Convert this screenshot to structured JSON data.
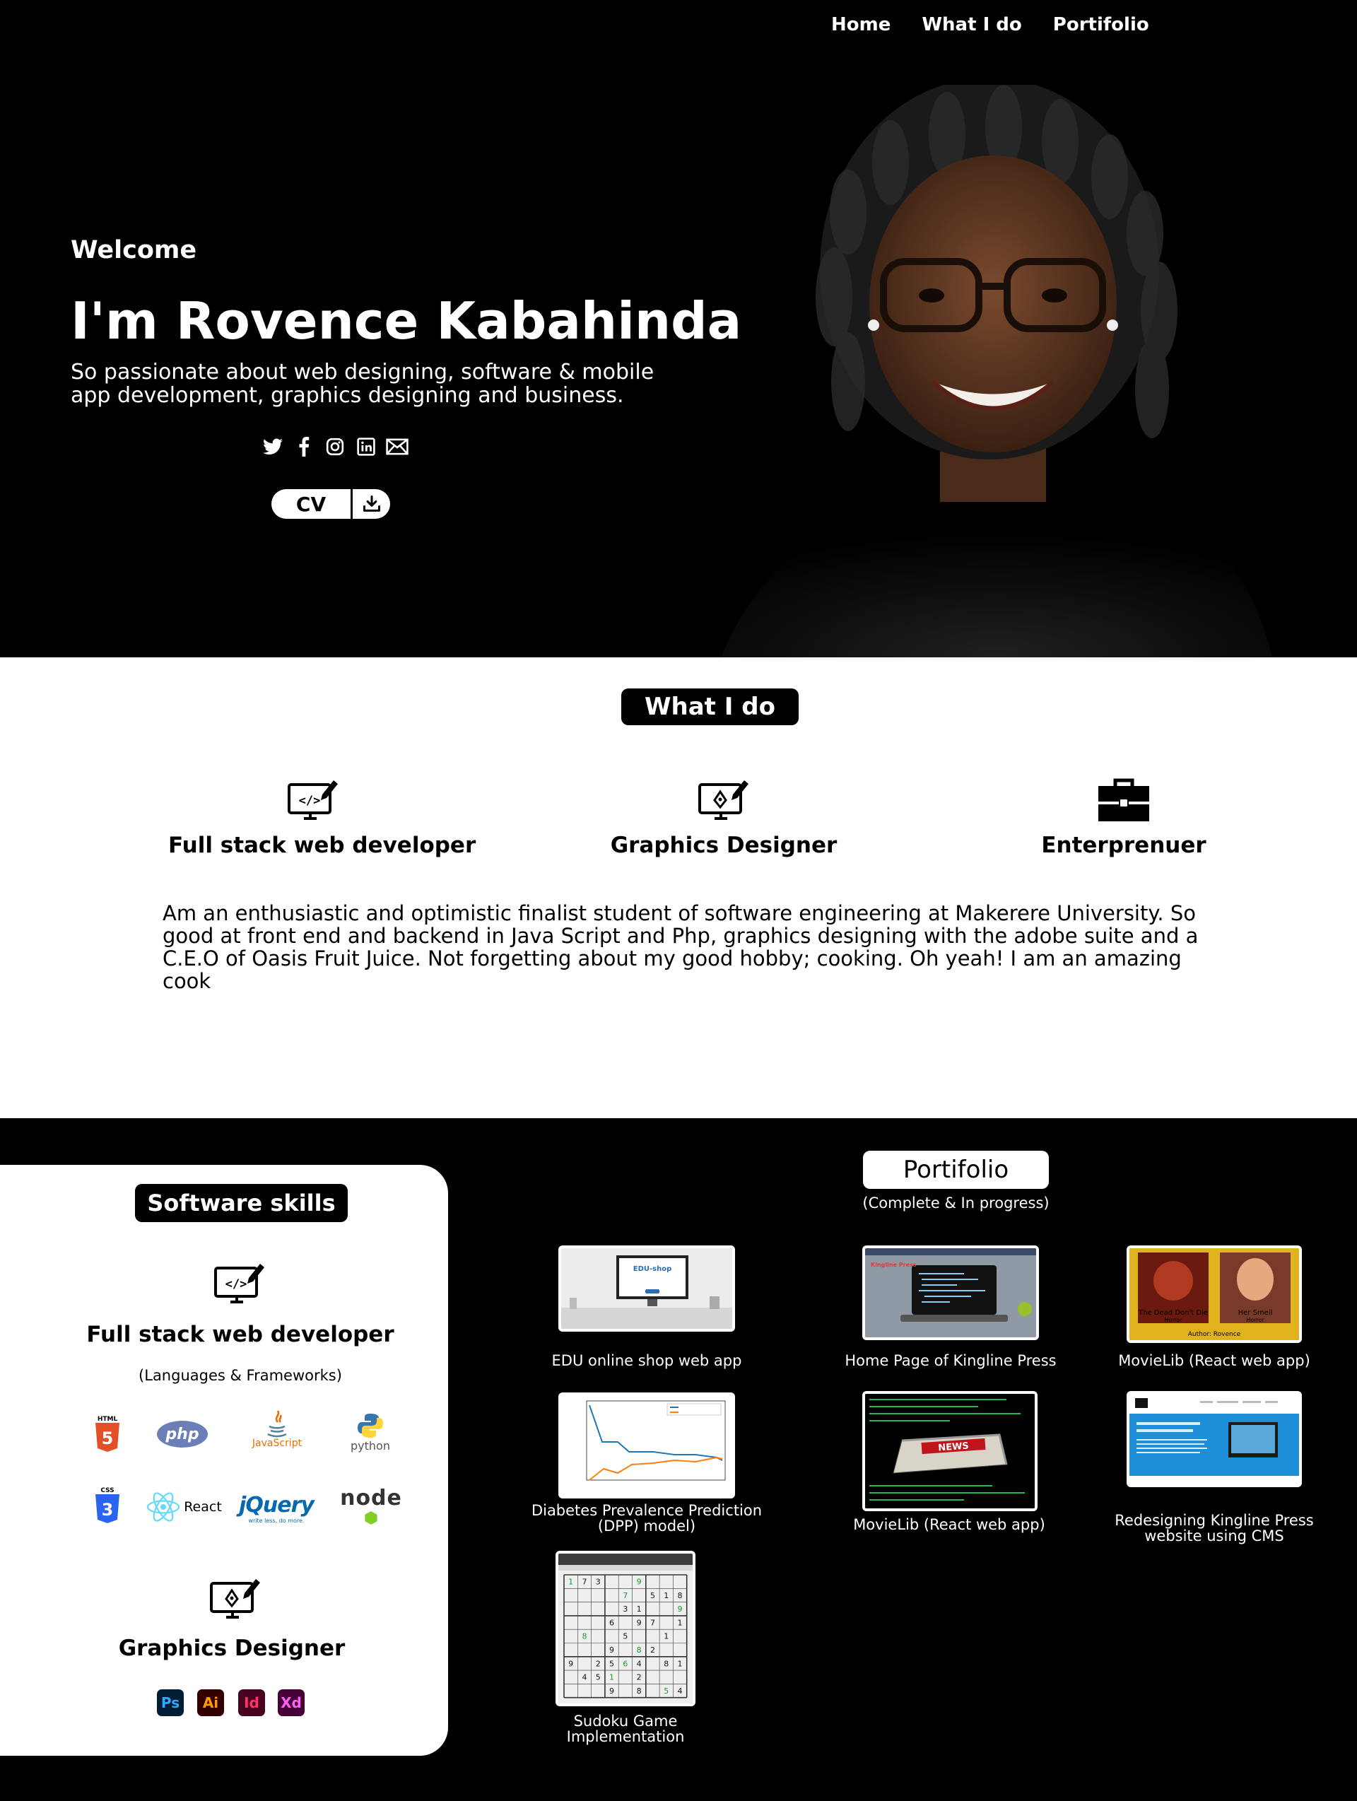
{
  "nav": {
    "items": [
      "Home",
      "What I do",
      "Portifolio"
    ]
  },
  "hero": {
    "welcome": "Welcome",
    "name": "I'm Rovence Kabahinda",
    "tagline": "So passionate about web designing, software & mobile app development, graphics designing and business.",
    "socials": [
      "twitter-icon",
      "facebook-icon",
      "instagram-icon",
      "linkedin-icon",
      "mail-icon"
    ],
    "cv_label": "CV"
  },
  "what_i_do": {
    "title": "What I do",
    "services": [
      {
        "label": "Full stack web developer",
        "icon": "code-monitor-icon"
      },
      {
        "label": "Graphics Designer",
        "icon": "design-monitor-icon"
      },
      {
        "label": "Enterprenuer",
        "icon": "briefcase-icon"
      }
    ],
    "about": "Am an enthusiastic and optimistic finalist student of software engineering at Makerere University. So good at front end and backend in Java Script and Php, graphics designing with the adobe suite and a C.E.O of Oasis Fruit Juice. Not forgetting about my good hobby; cooking. Oh yeah! I am an amazing cook"
  },
  "skills": {
    "title": "Software skills",
    "web": {
      "heading": "Full stack web developer",
      "note": "(Languages & Frameworks)",
      "logos": [
        "HTML",
        "php",
        "JavaScript",
        "python",
        "CSS",
        "React",
        "jQuery",
        "write less, do more.",
        "node"
      ]
    },
    "graphics": {
      "heading": "Graphics Designer",
      "apps": [
        "Ps",
        "Ai",
        "Id",
        "Xd"
      ],
      "app_colors": [
        "#31a8ff",
        "#ff9a00",
        "#ff3366",
        "#ff61f6"
      ]
    }
  },
  "portfolio": {
    "title": "Portifolio",
    "subtitle": "(Complete & In progress)",
    "projects": [
      {
        "caption": "EDU online shop web app",
        "thumb_text": "EDU-shop"
      },
      {
        "caption": "Home Page of Kingline Press",
        "thumb_text": "Kingline Press"
      },
      {
        "caption": "MovieLib (React web app)",
        "thumb_text": "Author: Rovence"
      },
      {
        "caption": "Diabetes Prevalence Prediction (DPP) model)",
        "thumb_text": ""
      },
      {
        "caption": "MovieLib (React web app)",
        "thumb_text": "NEWS"
      },
      {
        "caption": "Redesigning Kingline Press website using CMS",
        "thumb_text": ""
      },
      {
        "caption": "Sudoku Game Implementation",
        "thumb_text": ""
      }
    ],
    "movie_titles": [
      "The Dead Don't Die",
      "Horror",
      "Her Smell",
      "Horror"
    ],
    "sudoku_rows": [
      "173  9   ",
      "    7 518",
      "    31  97",
      "   6 97 1 ",
      " 8  5  1 ",
      "   9 82  ",
      "9 2564 81",
      " 451 2   ",
      "   9 8 54"
    ]
  }
}
